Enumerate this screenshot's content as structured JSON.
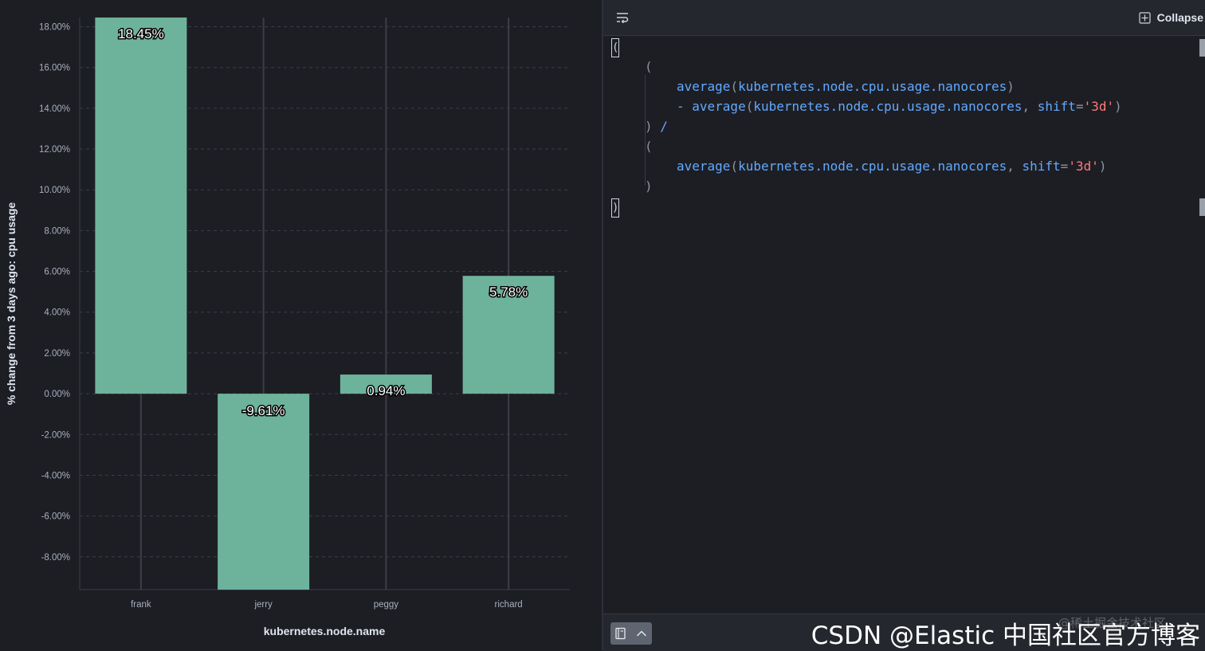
{
  "chart_data": {
    "type": "bar",
    "categories": [
      "frank",
      "jerry",
      "peggy",
      "richard"
    ],
    "values": [
      18.45,
      -9.61,
      0.94,
      5.78
    ],
    "value_labels": [
      "18.45%",
      "-9.61%",
      "0.94%",
      "5.78%"
    ],
    "xlabel": "kubernetes.node.name",
    "ylabel": "% change from 3 days ago: cpu usage",
    "y_ticks": [
      18,
      16,
      14,
      12,
      10,
      8,
      6,
      4,
      2,
      0,
      -2,
      -4,
      -6,
      -8
    ],
    "y_tick_labels": [
      "18.00%",
      "16.00%",
      "14.00%",
      "12.00%",
      "10.00%",
      "8.00%",
      "6.00%",
      "4.00%",
      "2.00%",
      "0.00%",
      "-2.00%",
      "-4.00%",
      "-6.00%",
      "-8.00%"
    ],
    "ylim": [
      -9.61,
      18.45
    ],
    "grid": true,
    "bar_color": "#6db39b"
  },
  "editor": {
    "toolbar": {
      "wrap_icon": "word-wrap-icon",
      "collapse_icon": "collapse-icon",
      "collapse_label": "Collapse"
    },
    "code_lines": [
      [
        {
          "t": "(",
          "c": "punct"
        }
      ],
      [
        {
          "t": "average",
          "c": "fn"
        },
        {
          "t": "(",
          "c": "punct"
        },
        {
          "t": "kubernetes.node.cpu.usage.nanocores",
          "c": "fn"
        },
        {
          "t": ")",
          "c": "punct"
        }
      ],
      [
        {
          "t": "- ",
          "c": "op"
        },
        {
          "t": "average",
          "c": "fn"
        },
        {
          "t": "(",
          "c": "punct"
        },
        {
          "t": "kubernetes.node.cpu.usage.nanocores",
          "c": "fn"
        },
        {
          "t": ", ",
          "c": "punct"
        },
        {
          "t": "shift",
          "c": "kw"
        },
        {
          "t": "=",
          "c": "punct"
        },
        {
          "t": "'3d'",
          "c": "str"
        },
        {
          "t": ")",
          "c": "punct"
        }
      ],
      [
        {
          "t": ") ",
          "c": "punct"
        },
        {
          "t": "/",
          "c": "op"
        }
      ],
      [
        {
          "t": "(",
          "c": "punct"
        }
      ],
      [
        {
          "t": "average",
          "c": "fn"
        },
        {
          "t": "(",
          "c": "punct"
        },
        {
          "t": "kubernetes.node.cpu.usage.nanocores",
          "c": "fn"
        },
        {
          "t": ", ",
          "c": "punct"
        },
        {
          "t": "shift",
          "c": "kw"
        },
        {
          "t": "=",
          "c": "punct"
        },
        {
          "t": "'3d'",
          "c": "str"
        },
        {
          "t": ")",
          "c": "punct"
        }
      ],
      [
        {
          "t": ")",
          "c": "punct"
        }
      ]
    ],
    "bracket_open": "(",
    "bracket_close": ")",
    "footer": {
      "docs_icon": "book-icon",
      "expand_icon": "chevron-up-icon"
    }
  },
  "watermark": "@稀土掘金技术社区",
  "credit": "CSDN @Elastic 中国社区官方博客"
}
